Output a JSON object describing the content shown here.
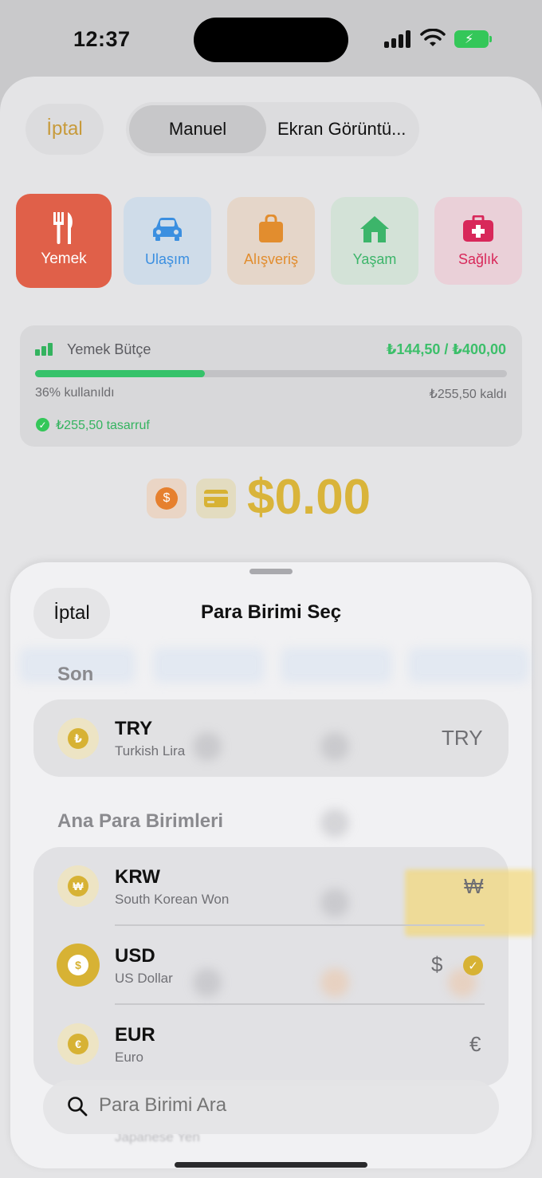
{
  "status_bar": {
    "time": "12:37"
  },
  "background": {
    "cancel_label": "İptal",
    "segments": [
      "Manuel",
      "Ekran Görüntü..."
    ],
    "categories": [
      {
        "label": "Yemek",
        "color": "#e06049",
        "active": true
      },
      {
        "label": "Ulaşım",
        "color": "#3b8fe0"
      },
      {
        "label": "Alışveriş",
        "color": "#e28d2e"
      },
      {
        "label": "Yaşam",
        "color": "#3cb56a"
      },
      {
        "label": "Sağlık",
        "color": "#d8285a"
      }
    ],
    "budget": {
      "title": "Yemek Bütçe",
      "amount": "₺144,50 / ₺400,00",
      "progress_fraction": 0.36,
      "used_text": "36% kullanıldı",
      "remaining_text": "₺255,50 kaldı",
      "savings_text": "₺255,50 tasarruf"
    },
    "amount_display": "$0.00",
    "dollar_icon_label": "$"
  },
  "modal": {
    "cancel_label": "İptal",
    "title": "Para Birimi Seç",
    "recent_section": "Son",
    "main_section": "Ana Para Birimleri",
    "recent": [
      {
        "code": "TRY",
        "name": "Turkish Lira",
        "symbol": "TRY",
        "coin": "₺"
      }
    ],
    "main": [
      {
        "code": "KRW",
        "name": "South Korean Won",
        "symbol": "₩",
        "coin": "₩"
      },
      {
        "code": "USD",
        "name": "US Dollar",
        "symbol": "$",
        "coin": "$",
        "selected": true
      },
      {
        "code": "EUR",
        "name": "Euro",
        "symbol": "€",
        "coin": "€"
      }
    ],
    "partial_row_name": "Japanese Yen",
    "search_placeholder": "Para Birimi Ara",
    "accent": "#d7b234"
  }
}
